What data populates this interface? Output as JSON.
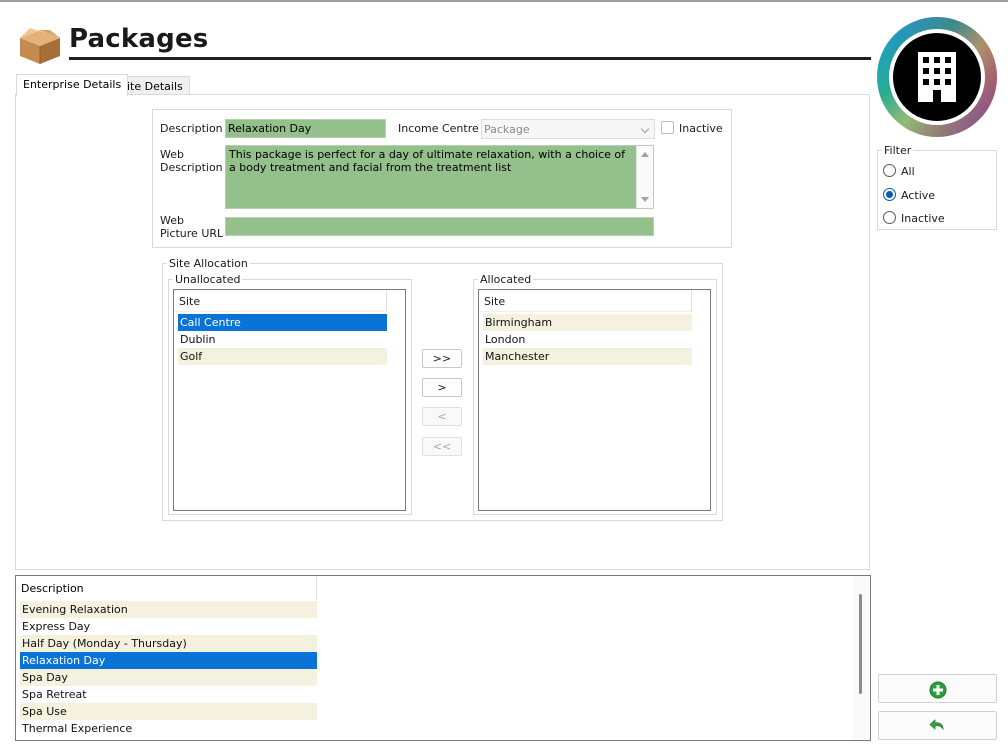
{
  "header": {
    "title": "Packages"
  },
  "tabs": [
    {
      "label": "Enterprise Details",
      "active": true
    },
    {
      "label": "Site Details",
      "active": false
    }
  ],
  "details": {
    "description_label": "Description",
    "description_value": "Relaxation Day",
    "web_description_label_1": "Web",
    "web_description_label_2": "Description",
    "web_description_value": "This package is perfect for a day of ultimate relaxation, with a choice of a body treatment and facial from the treatment list",
    "web_picture_label_1": "Web",
    "web_picture_label_2": "Picture URL",
    "web_picture_value": "",
    "income_centre_label": "Income Centre",
    "income_centre_value": "Package",
    "inactive_label": "Inactive",
    "field_color": "#93c08b"
  },
  "site_allocation": {
    "group_label": "Site Allocation",
    "unallocated": {
      "label": "Unallocated",
      "header": "Site",
      "rows": [
        "Call Centre",
        "Dublin",
        "Golf"
      ],
      "selected_index": 0
    },
    "allocated": {
      "label": "Allocated",
      "header": "Site",
      "rows": [
        "Birmingham",
        "London",
        "Manchester"
      ]
    },
    "buttons": {
      "move_all_right": ">>",
      "move_right": ">",
      "move_left": "<",
      "move_all_left": "<<"
    }
  },
  "package_list": {
    "header": "Description",
    "rows": [
      "Evening Relaxation",
      "Express Day",
      "Half Day (Monday - Thursday)",
      "Relaxation Day",
      "Spa Day",
      "Spa Retreat",
      "Spa Use",
      "Thermal Experience"
    ],
    "selected_index": 3
  },
  "filter": {
    "label": "Filter",
    "options": [
      "All",
      "Active",
      "Inactive"
    ],
    "selected": "Active"
  },
  "colors": {
    "selection": "#0a74d6",
    "alt_row": "#f4f1de",
    "add_green": "#2e9e3a"
  },
  "icons": {
    "header": "package-box-icon",
    "logo": "building-icon",
    "add": "add-circle-icon",
    "undo": "undo-arrow-icon"
  }
}
